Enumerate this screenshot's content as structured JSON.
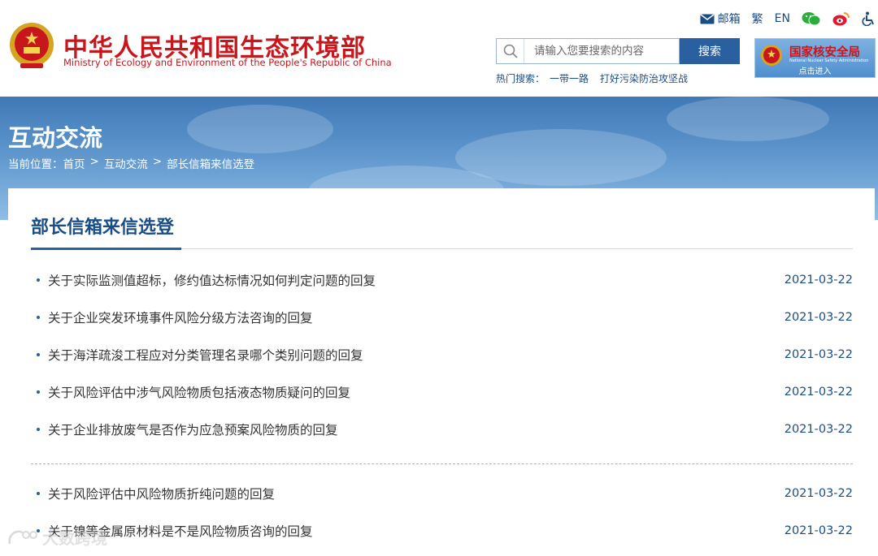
{
  "header": {
    "title": "中华人民共和国生态环境部",
    "subtitle": "Ministry of Ecology and Environment of the People's Republic of China",
    "toplinks": {
      "mail": "邮箱",
      "traditional": "繁",
      "english": "EN"
    },
    "search": {
      "placeholder": "请输入您要搜索的内容",
      "button": "搜索"
    },
    "hot_search": {
      "label": "热门搜索：",
      "items": [
        "一带一路",
        "打好污染防治攻坚战"
      ]
    },
    "nna": {
      "name": "国家核安全局",
      "english": "National Nuclear Safety Administration",
      "enter": "点击进入"
    },
    "colors": {
      "brand_red": "#c8161d",
      "brand_blue": "#1a4d86",
      "button_blue": "#2a5fa0"
    }
  },
  "banner": {
    "title": "互动交流",
    "breadcrumb": {
      "label": "当前位置：",
      "items": [
        "首页",
        "互动交流",
        "部长信箱来信选登"
      ],
      "separator": ">"
    }
  },
  "main": {
    "section_title": "部长信箱来信选登",
    "items": [
      {
        "title": "关于实际监测值超标，修约值达标情况如何判定问题的回复",
        "date": "2021-03-22"
      },
      {
        "title": "关于企业突发环境事件风险分级方法咨询的回复",
        "date": "2021-03-22"
      },
      {
        "title": "关于海洋疏浚工程应对分类管理名录哪个类别问题的回复",
        "date": "2021-03-22"
      },
      {
        "title": "关于风险评估中涉气风险物质包括液态物质疑问的回复",
        "date": "2021-03-22"
      },
      {
        "title": "关于企业排放废气是否作为应急预案风险物质的回复",
        "date": "2021-03-22"
      },
      {
        "title": "关于风险评估中风险物质折纯问题的回复",
        "date": "2021-03-22"
      },
      {
        "title": "关于镍等金属原材料是不是风险物质咨询的回复",
        "date": "2021-03-22"
      }
    ]
  },
  "watermark": {
    "text": "大数跨境"
  }
}
